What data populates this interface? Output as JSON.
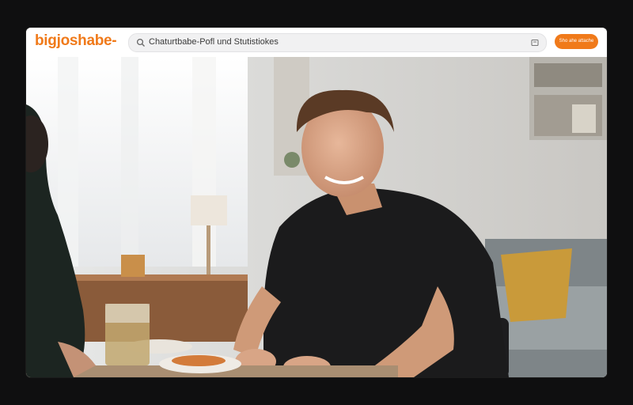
{
  "colors": {
    "accent": "#f07a1a"
  },
  "header": {
    "logo_text": "bigjoshabe-",
    "search_icon": "search-icon",
    "search_value": "Chaturtbabe-Pofl und Stutistiokes",
    "clip_icon": "bookmark-icon",
    "cta_label": "Sho ahe attache"
  },
  "main": {
    "image_alt": "Smiling young man in a black t-shirt sitting at a table in a living room"
  }
}
